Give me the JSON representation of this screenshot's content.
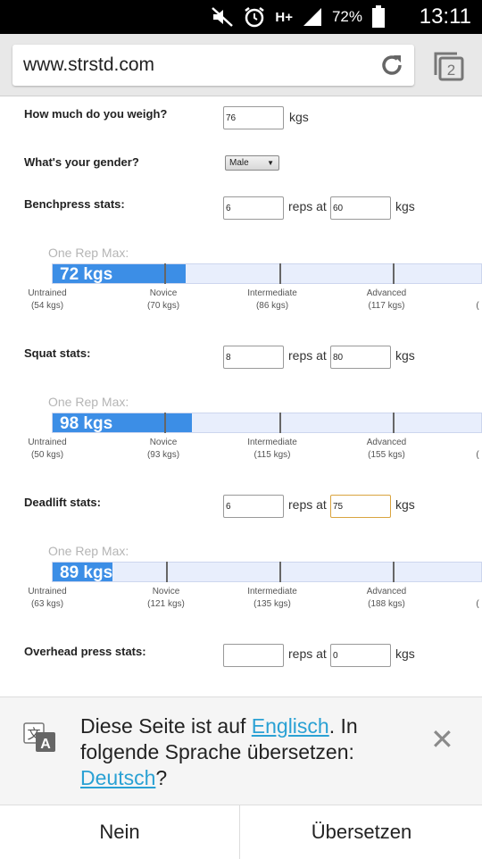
{
  "status_bar": {
    "network": "H+",
    "battery_percent": "72%",
    "time": "13:11",
    "icons": [
      "mute-icon",
      "alarm-icon",
      "network-icon",
      "signal-icon",
      "battery-icon"
    ]
  },
  "browser": {
    "url": "www.strstd.com",
    "tab_count": "2"
  },
  "form": {
    "weight": {
      "label": "How much do you weigh?",
      "value": "76",
      "unit": "kgs"
    },
    "gender": {
      "label": "What's your gender?",
      "value": "Male"
    },
    "reps_at": "reps at",
    "kgs": "kgs",
    "one_rep_max_label": "One Rep Max:",
    "level_names": {
      "untrained": "Untrained",
      "novice": "Novice",
      "intermediate": "Intermediate",
      "advanced": "Advanced",
      "elite": "("
    },
    "lifts": {
      "bench": {
        "label": "Benchpress stats:",
        "reps": "6",
        "weight": "60",
        "orm": "72 kgs",
        "fill_fraction": 0.31,
        "levels": {
          "untrained": "(54 kgs)",
          "novice": "(70 kgs)",
          "intermediate": "(86 kgs)",
          "advanced": "(117 kgs)"
        }
      },
      "squat": {
        "label": "Squat stats:",
        "reps": "8",
        "weight": "80",
        "orm": "98 kgs",
        "fill_fraction": 0.325,
        "levels": {
          "untrained": "(50 kgs)",
          "novice": "(93 kgs)",
          "intermediate": "(115 kgs)",
          "advanced": "(155 kgs)"
        }
      },
      "deadlift": {
        "label": "Deadlift stats:",
        "reps": "6",
        "weight": "75",
        "orm": "89 kgs",
        "fill_fraction": 0.14,
        "levels": {
          "untrained": "(63 kgs)",
          "novice": "(121 kgs)",
          "intermediate": "(135 kgs)",
          "advanced": "(188 kgs)"
        }
      },
      "overhead": {
        "label": "Overhead press stats:",
        "reps": "",
        "weight": "0"
      }
    }
  },
  "translate_bar": {
    "text_1": "Diese Seite ist auf ",
    "source_language": "Englisch",
    "text_2": ". In folgende Sprache übersetzen: ",
    "target_language": "Deutsch",
    "text_3": "?",
    "no_button": "Nein",
    "translate_button": "Übersetzen"
  },
  "colors": {
    "bar_fill": "#3c8ee6",
    "bar_bg": "#e8eefc",
    "link": "#2aa1d4"
  }
}
